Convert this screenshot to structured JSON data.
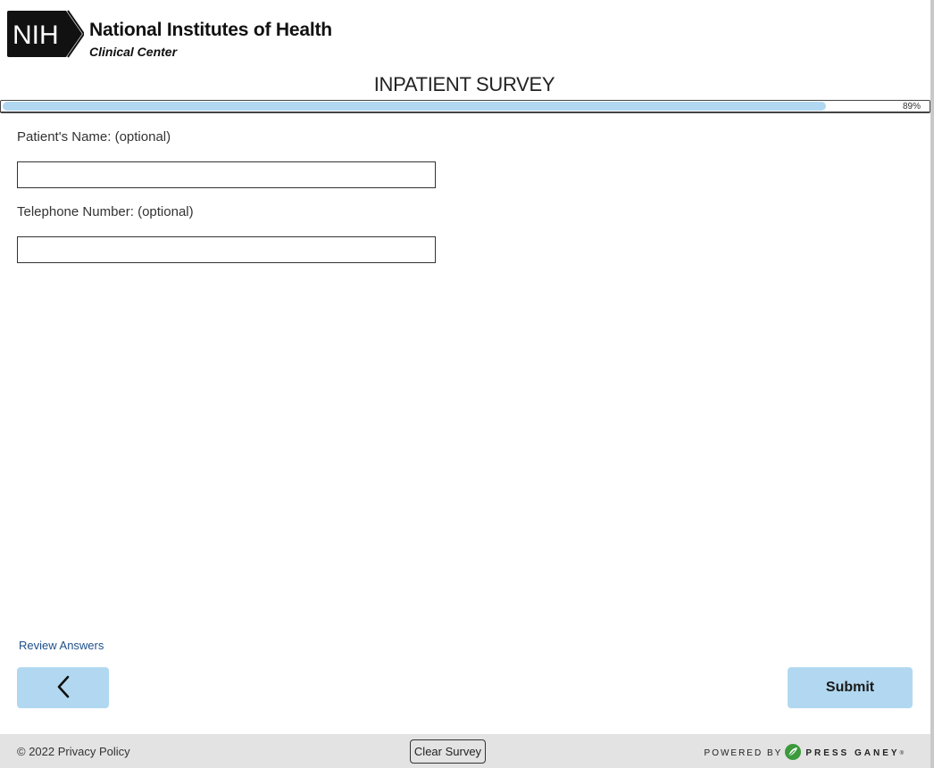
{
  "header": {
    "logo_badge_text": "NIH",
    "logo_line1": "National Institutes of Health",
    "logo_line2": "Clinical Center",
    "survey_title": "INPATIENT SURVEY"
  },
  "progress": {
    "percent": 89,
    "label": "89%"
  },
  "form": {
    "fields": [
      {
        "label": "Patient's Name: (optional)",
        "value": "",
        "placeholder": ""
      },
      {
        "label": "Telephone Number: (optional)",
        "value": "",
        "placeholder": ""
      }
    ]
  },
  "nav": {
    "review_link": "Review Answers",
    "back_icon": "chevron-left-icon",
    "submit_label": "Submit"
  },
  "footer": {
    "copyright": "© 2022 Privacy Policy",
    "clear_label": "Clear Survey",
    "powered_by": "POWERED BY",
    "brand": "PRESS GANEY",
    "brand_mark": "®"
  },
  "colors": {
    "accent": "#b1d8f0",
    "link": "#1e4f8a",
    "footer_bg": "#e3e3e3",
    "brand_green": "#3a9a3c"
  }
}
